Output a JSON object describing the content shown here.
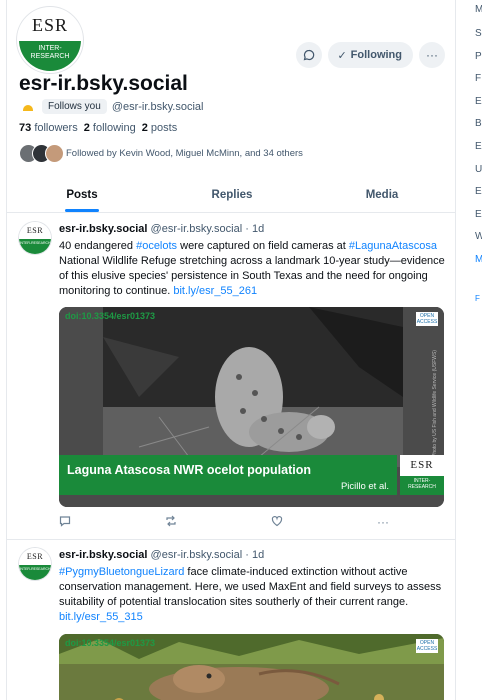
{
  "profile": {
    "logo_top": "ESR",
    "logo_bottom": "INTER-RESEARCH",
    "display_name": "esr-ir.bsky.social",
    "follows_badge": "Follows you",
    "handle": "@esr-ir.bsky.social",
    "followers_count": "73",
    "followers_label": "followers",
    "following_count": "2",
    "following_label": "following",
    "posts_count": "2",
    "posts_label": "posts",
    "followed_by": "Followed by Kevin Wood, Miguel McMinn, and 34 others",
    "following_button": "Following",
    "chat_icon": "chat-bubble-icon",
    "more_icon": "ellipsis-icon"
  },
  "tabs": [
    {
      "label": "Posts"
    },
    {
      "label": "Replies"
    },
    {
      "label": "Media"
    }
  ],
  "posts": [
    {
      "author": "esr-ir.bsky.social",
      "handle": "@esr-ir.bsky.social",
      "time": "1d",
      "text_1": "40 endangered ",
      "tag_1": "#ocelots",
      "text_2": " were captured on field cameras at ",
      "tag_2": "#LagunaAtascosa",
      "text_3": " National Wildlife Refuge stretching across a landmark 10-year study—evidence of this elusive species' persistence in South Texas and the need for ongoing monitoring to continue. ",
      "link": "bit.ly/esr_55_261",
      "media": {
        "doi": "doi:10.3354/esr01373",
        "open_access": "OPEN ACCESS",
        "credit": "Photo by US Fish and Wildlife Service (USFWS)",
        "caption_title": "Laguna Atascosa NWR ocelot population",
        "caption_author": "Picillo et al."
      }
    },
    {
      "author": "esr-ir.bsky.social",
      "handle": "@esr-ir.bsky.social",
      "time": "1d",
      "tag_1": "#PygmyBluetongueLizard",
      "text_1": " face climate-induced extinction without active conservation management. Here, we used MaxEnt and field surveys to assess suitability of potential translocation sites southerly of their current range. ",
      "link": "bit.ly/esr_55_315",
      "media": {
        "doi": "doi:10.3354/esr01373",
        "open_access": "OPEN ACCESS"
      }
    }
  ],
  "right_column_letters": [
    "M",
    "S",
    "P",
    "F",
    "E",
    "B",
    "E",
    "U",
    "E",
    "E",
    "W",
    "M",
    "F"
  ],
  "colors": {
    "accent": "#1083fe",
    "brand_green": "#1a8a3a",
    "muted_text": "#42576c"
  }
}
